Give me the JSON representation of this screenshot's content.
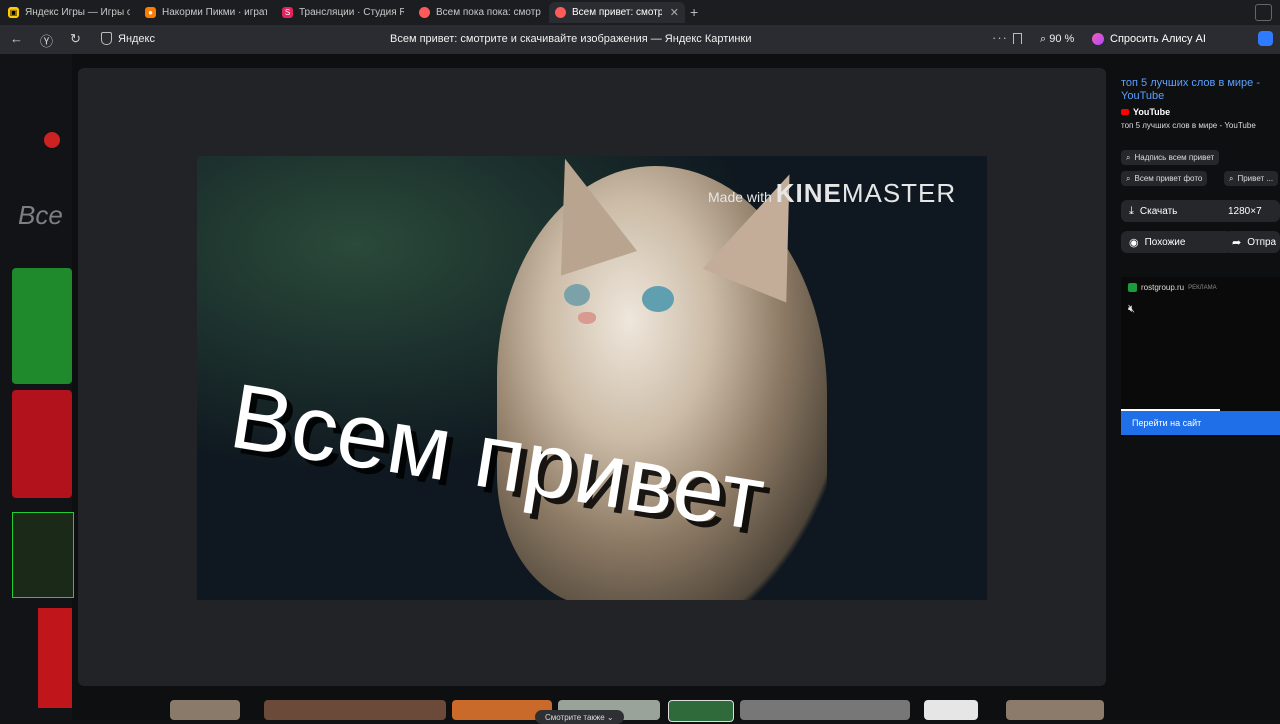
{
  "tabs": [
    {
      "label": "Яндекс Игры — Игры онл",
      "icon": "yandex-games-icon",
      "color": "#ffcc00"
    },
    {
      "label": "Накорми Пикми · играть",
      "icon": "game-icon",
      "color": "#ff7a00"
    },
    {
      "label": "Трансляции · Студия RUT",
      "icon": "rutube-icon",
      "color": "#e0245e"
    },
    {
      "label": "Всем пока пока: смотри",
      "icon": "yandex-images-icon",
      "color": "#ff5a5a"
    },
    {
      "label": "Всем привет: смотри",
      "icon": "yandex-images-icon",
      "color": "#ff5a5a",
      "active": true
    }
  ],
  "addressbar": {
    "site": "Яндекс",
    "page_title": "Всем привет: смотрите и скачивайте изображения — Яндекс Картинки",
    "zoom": "90 %",
    "alice_label": "Спросить Алису AI"
  },
  "image": {
    "watermark_prefix": "Made with",
    "watermark_brand_bold": "KINE",
    "watermark_brand": "MASTER",
    "caption": "Всем привет"
  },
  "left_strip": {
    "text": "Все"
  },
  "sidepanel": {
    "title": "топ 5 лучших слов в мире - YouTube",
    "source": "YouTube",
    "description": "топ 5 лучших слов в мире - YouTube",
    "chips": [
      "Надпись всем привет",
      "Всем привет фото",
      "Привет ..."
    ],
    "download_label": "Скачать",
    "resolution": "1280×7",
    "similar_label": "Похожие",
    "share_label": "Отпра"
  },
  "ad": {
    "domain": "rostgroup.ru",
    "tag": "РЕКЛАМА",
    "button_label": "Перейти на сайт",
    "progress": 0.62
  },
  "bottom": {
    "see_also": "Смотрите также ⌄"
  }
}
